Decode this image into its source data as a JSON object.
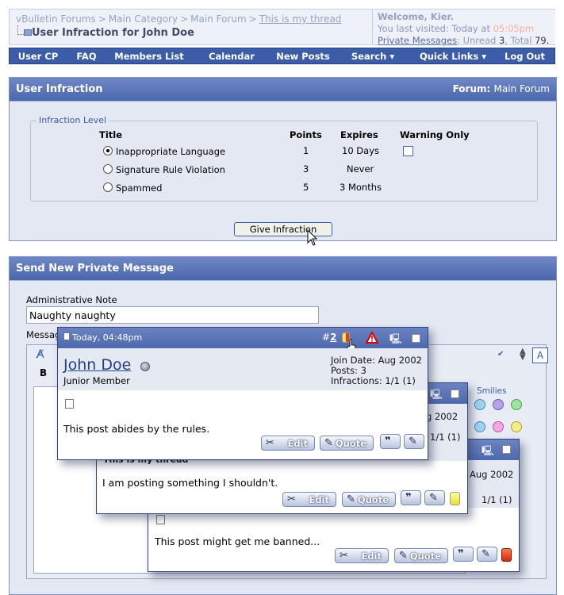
{
  "header": {
    "breadcrumb": [
      "vBulletin Forums",
      "Main Category",
      "Main Forum",
      "This is my thread"
    ],
    "breadcrumb_sep": ">",
    "page_title": "User Infraction for John Doe",
    "welcome": {
      "greeting": "Welcome, Kier.",
      "last_visited_label": "You last visited: Today at",
      "last_visited_time": "05:05pm",
      "pm_link": "Private Messages",
      "pm_counts_prefix": ": Unread",
      "pm_unread": "3",
      "pm_total_prefix": ", Total",
      "pm_total": "79."
    }
  },
  "nav": {
    "items": [
      {
        "label": "User CP"
      },
      {
        "label": "FAQ"
      },
      {
        "label": "Members List"
      },
      {
        "label": "Calendar"
      },
      {
        "label": "New Posts"
      },
      {
        "label": "Search ▾"
      },
      {
        "label": "Quick Links ▾"
      },
      {
        "label": "Log Out"
      }
    ]
  },
  "infraction": {
    "title": "User Infraction",
    "forum_label": "Forum:",
    "forum_name": "Main Forum",
    "legend": "Infraction Level",
    "columns": {
      "title": "Title",
      "points": "Points",
      "expires": "Expires",
      "warning": "Warning Only"
    },
    "rows": [
      {
        "title": "Inappropriate Language",
        "points": "1",
        "expires": "10 Days",
        "selected": true
      },
      {
        "title": "Signature Rule Violation",
        "points": "3",
        "expires": "Never",
        "selected": false
      },
      {
        "title": "Spammed",
        "points": "5",
        "expires": "3 Months",
        "selected": false
      }
    ],
    "give_button": "Give Infraction"
  },
  "pm": {
    "title": "Send New Private Message",
    "admin_note_label": "Administrative Note",
    "admin_note_value": "Naughty naughty",
    "message_label": "Messag",
    "smilies_label": "Smilies"
  },
  "posts": [
    {
      "date": "Today, 04:48pm",
      "number_prefix": "#",
      "number": "2",
      "username": "John Doe",
      "user_title": "Junior Member",
      "join_date": "Join Date: Aug 2002",
      "posts": "Posts: 3",
      "infractions": "Infractions: 1/1 (1)",
      "text": "This post abides by the rules.",
      "edit": "Edit",
      "quote": "Quote"
    },
    {
      "thread_title": "This is my thread",
      "join_date": "g 2002",
      "infractions": "1/1 (1)",
      "text": "I am posting something I shouldn't.",
      "edit": "Edit",
      "quote": "Quote"
    },
    {
      "join_date": "Aug 2002",
      "infractions": "1/1 (1)",
      "text": "This post might get me banned...",
      "edit": "Edit",
      "quote": "Quote"
    }
  ],
  "colors": {
    "accent": "#3b5da8",
    "panel_bg": "#e3e8f2",
    "header_grad_top": "#6f87c6"
  }
}
